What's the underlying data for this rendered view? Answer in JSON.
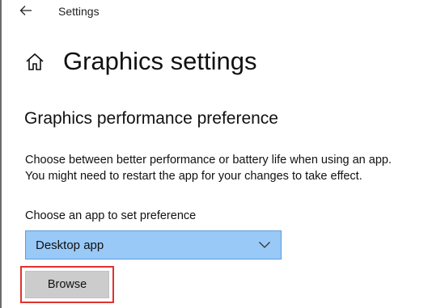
{
  "window": {
    "title": "Settings",
    "back_icon": "back-arrow-icon"
  },
  "page": {
    "home_icon": "home-icon",
    "title": "Graphics settings"
  },
  "section": {
    "title": "Graphics performance preference",
    "description_line1": "Choose between better performance or battery life when using an app.",
    "description_line2": "You might need to restart the app for your changes to take effect."
  },
  "app_select": {
    "label": "Choose an app to set preference",
    "selected": "Desktop app",
    "chevron_icon": "chevron-down-icon",
    "accent_color": "#99c9f7"
  },
  "browse": {
    "label": "Browse",
    "highlight_color": "#e0322d"
  }
}
